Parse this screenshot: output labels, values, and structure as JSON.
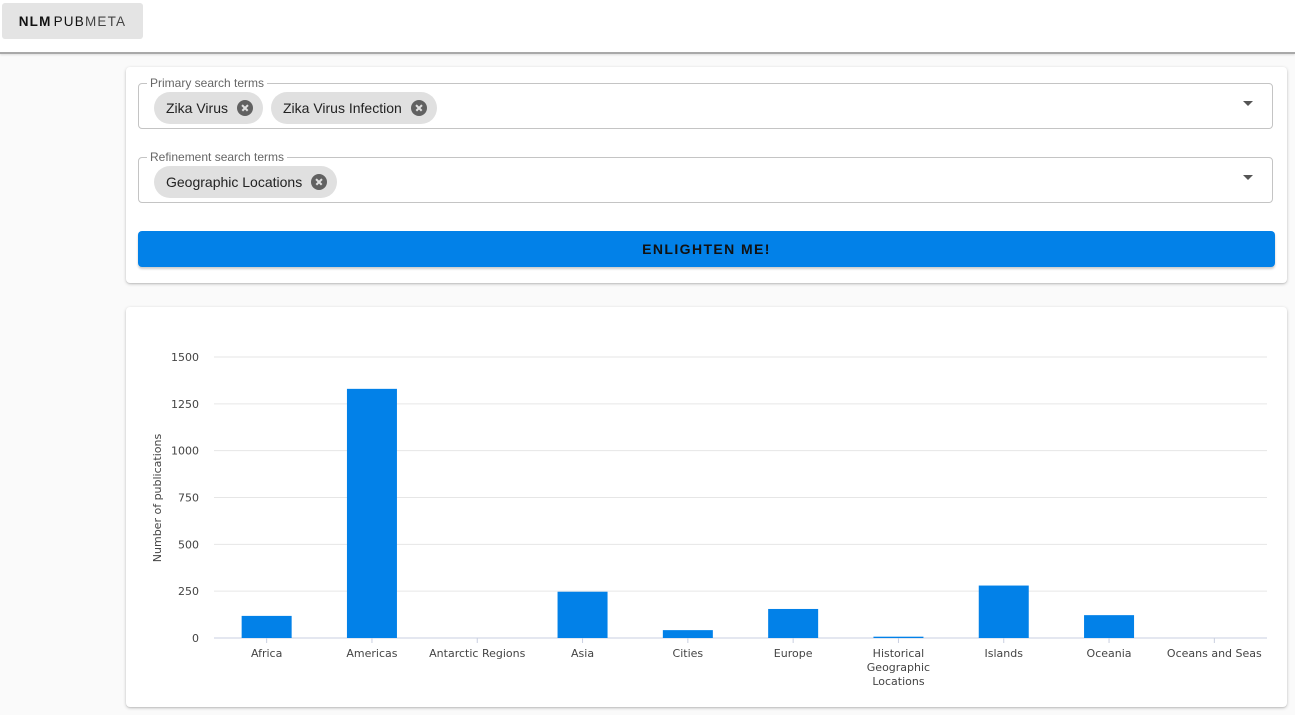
{
  "app": {
    "logo": {
      "part1": "NLM",
      "part2": "PUB",
      "part3": "META"
    }
  },
  "search": {
    "primary": {
      "label": "Primary search terms",
      "chips": [
        "Zika Virus",
        "Zika Virus Infection"
      ]
    },
    "refinement": {
      "label": "Refinement search terms",
      "chips": [
        "Geographic Locations"
      ]
    },
    "button_label": "ENLIGHTEN ME!"
  },
  "colors": {
    "accent": "#0281e8",
    "chip_bg": "#e0e0e0",
    "grid": "#e6e6e6"
  },
  "chart_data": {
    "type": "bar",
    "categories": [
      [
        "Africa"
      ],
      [
        "Americas"
      ],
      [
        "Antarctic Regions"
      ],
      [
        "Asia"
      ],
      [
        "Cities"
      ],
      [
        "Europe"
      ],
      [
        "Historical",
        "Geographic",
        "Locations"
      ],
      [
        "Islands"
      ],
      [
        "Oceania"
      ],
      [
        "Oceans and Seas"
      ]
    ],
    "values": [
      118,
      1330,
      0,
      247,
      42,
      155,
      7,
      280,
      122,
      0
    ],
    "title": "",
    "xlabel": "",
    "ylabel": "Number of publications",
    "ylim": [
      0,
      1500
    ],
    "yticks": [
      0,
      250,
      500,
      750,
      1000,
      1250,
      1500
    ],
    "grid": true,
    "legend": "none"
  }
}
